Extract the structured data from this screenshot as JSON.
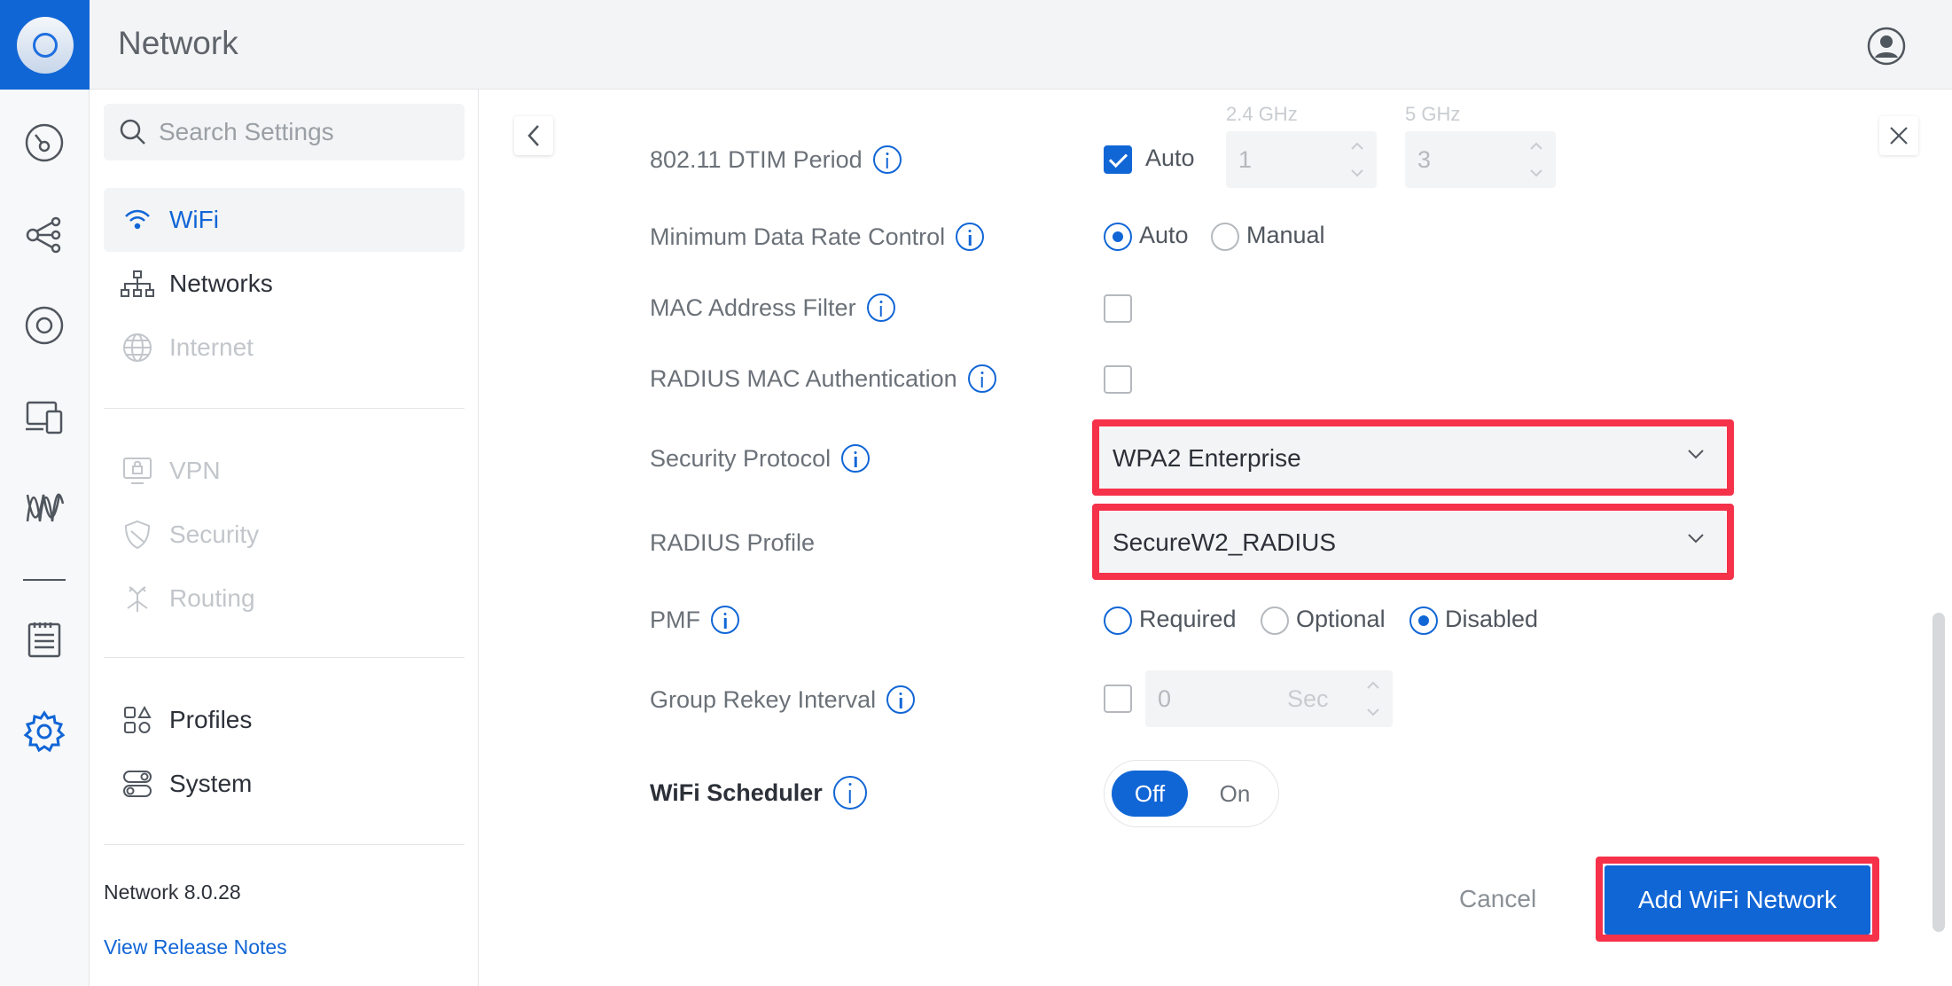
{
  "header": {
    "title": "Network"
  },
  "sidebar": {
    "search_placeholder": "Search Settings",
    "items": [
      {
        "label": "WiFi",
        "state": "active",
        "icon": "wifi-icon"
      },
      {
        "label": "Networks",
        "state": "normal",
        "icon": "network-tree-icon"
      },
      {
        "label": "Internet",
        "state": "disabled",
        "icon": "globe-icon"
      },
      {
        "label": "VPN",
        "state": "disabled",
        "icon": "vpn-icon"
      },
      {
        "label": "Security",
        "state": "disabled",
        "icon": "shield-icon"
      },
      {
        "label": "Routing",
        "state": "disabled",
        "icon": "routing-icon"
      },
      {
        "label": "Profiles",
        "state": "normal",
        "icon": "profiles-icon"
      },
      {
        "label": "System",
        "state": "normal",
        "icon": "system-icon"
      }
    ],
    "version": "Network 8.0.28",
    "release_notes": "View Release Notes"
  },
  "form": {
    "dtim": {
      "label": "802.11 DTIM Period",
      "auto_label": "Auto",
      "auto_checked": true,
      "band_24_label": "2.4 GHz",
      "band_24_value": "1",
      "band_5_label": "5 GHz",
      "band_5_value": "3"
    },
    "min_data_rate": {
      "label": "Minimum Data Rate Control",
      "options": [
        "Auto",
        "Manual"
      ],
      "selected": "Auto"
    },
    "mac_filter": {
      "label": "MAC Address Filter",
      "checked": false
    },
    "radius_mac_auth": {
      "label": "RADIUS MAC Authentication",
      "checked": false
    },
    "security_protocol": {
      "label": "Security Protocol",
      "value": "WPA2 Enterprise"
    },
    "radius_profile": {
      "label": "RADIUS Profile",
      "value": "SecureW2_RADIUS"
    },
    "pmf": {
      "label": "PMF",
      "options": [
        "Required",
        "Optional",
        "Disabled"
      ],
      "selected": "Disabled"
    },
    "group_rekey": {
      "label": "Group Rekey Interval",
      "checked": false,
      "value": "0",
      "unit": "Sec"
    },
    "wifi_scheduler": {
      "label": "WiFi Scheduler",
      "off_label": "Off",
      "on_label": "On",
      "state": "Off"
    }
  },
  "actions": {
    "cancel": "Cancel",
    "submit": "Add WiFi Network"
  },
  "colors": {
    "accent": "#1166d6",
    "highlight": "#f5324a"
  }
}
